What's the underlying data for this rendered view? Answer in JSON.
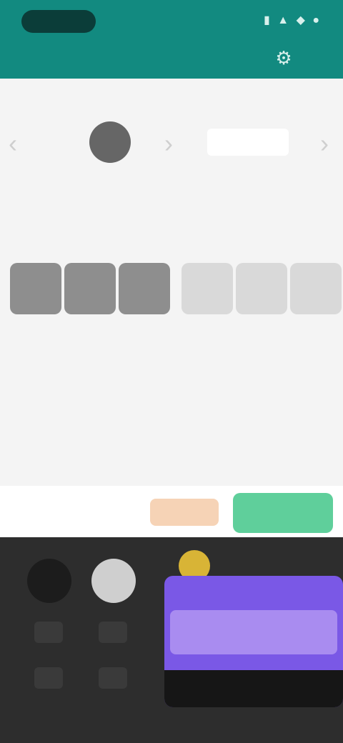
{
  "status": {
    "right_icons": "▮ ▲ ◆ ●"
  },
  "header": {
    "title": "",
    "action_icon": "gear-icon"
  },
  "code": {
    "left_caret": "‹",
    "mid_caret": "›",
    "right_caret": "›"
  },
  "boxes": {
    "caption_1": "",
    "caption_2": ""
  },
  "actions": {
    "left_label": "",
    "mid_label": "",
    "primary_label": ""
  },
  "panel": {
    "top_text": "",
    "ad_inner": "",
    "ad_footer": ""
  },
  "colors": {
    "accent": "#128a80",
    "primary_button": "#5fcf9b",
    "secondary_button": "#f6d3b6",
    "ad_purple": "#7a58e6"
  }
}
